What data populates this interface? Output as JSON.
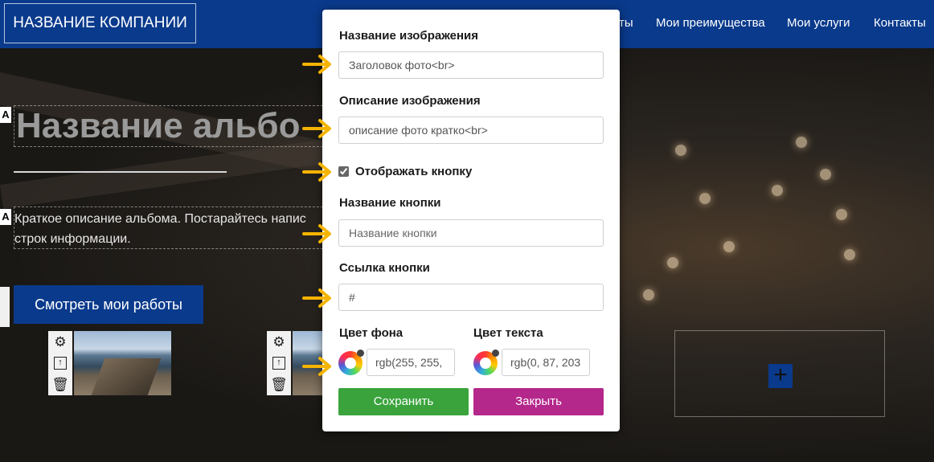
{
  "navbar": {
    "brand": "НАЗВАНИЕ КОМПАНИИ",
    "links": [
      "ты",
      "Мои преимущества",
      "Мои услуги",
      "Контакты"
    ]
  },
  "hero": {
    "title": "Название альбо",
    "description": "Краткое описание альбома. Постарайтесь напис строк информации.",
    "button_label": "Смотреть мои работы",
    "edit_glyph": "A"
  },
  "thumbnails": [
    {
      "tools": [
        "gear-icon",
        "upload-icon",
        "trash-icon"
      ]
    },
    {
      "tools": [
        "gear-icon",
        "upload-icon",
        "trash-icon"
      ]
    }
  ],
  "add_block": {
    "symbol": "+"
  },
  "modal": {
    "image_title_label": "Название изображения",
    "image_title_value": "Заголовок фото<br>",
    "image_desc_label": "Описание изображения",
    "image_desc_value": "описание фото кратко<br>",
    "show_button_label": "Отображать кнопку",
    "show_button_checked": true,
    "button_name_label": "Название кнопки",
    "button_name_placeholder": "Название кнопки",
    "button_link_label": "Ссылка кнопки",
    "button_link_value": "#",
    "bg_color_label": "Цвет фона",
    "bg_color_value": "rgb(255, 255,",
    "text_color_label": "Цвет текста",
    "text_color_value": "rgb(0, 87, 203",
    "save_label": "Сохранить",
    "close_label": "Закрыть"
  },
  "colors": {
    "brand_blue": "#0a3a8c",
    "save_green": "#3aa33c",
    "close_magenta": "#b4278b",
    "arrow_yellow": "#f5b400"
  }
}
